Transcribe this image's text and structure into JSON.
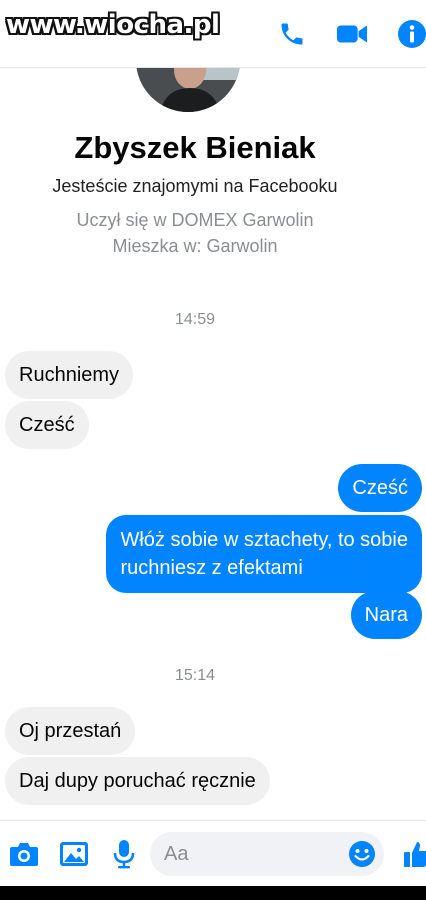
{
  "watermark": "www.wiocha.pl",
  "header": {
    "icons": [
      "phone-icon",
      "video-camera-icon",
      "info-icon"
    ],
    "accent": "#0084ff"
  },
  "profile": {
    "name": "Zbyszek Bieniak",
    "friends_text": "Jesteście znajomymi na Facebooku",
    "education": "Uczył się w DOMEX Garwolin",
    "location": "Mieszka w: Garwolin"
  },
  "messages": {
    "time1": "14:59",
    "m1": "Ruchniemy",
    "m2": "Cześć",
    "m3": "Cześć",
    "m4_line1": "Włóż sobie w sztachety, to sobie",
    "m4_line2": "ruchniesz z efektami",
    "m5": "Nara",
    "time2": "15:14",
    "m6": "Oj przestań",
    "m7": "Daj dupy poruchać ręcznie"
  },
  "composer": {
    "placeholder": "Aa",
    "icons": [
      "camera-icon",
      "gallery-icon",
      "microphone-icon",
      "emoji-icon",
      "thumbs-up-icon"
    ]
  },
  "colors": {
    "outgoing_bubble": "#0084ff",
    "incoming_bubble": "#f0f0f0",
    "muted_text": "#8a8d91"
  }
}
